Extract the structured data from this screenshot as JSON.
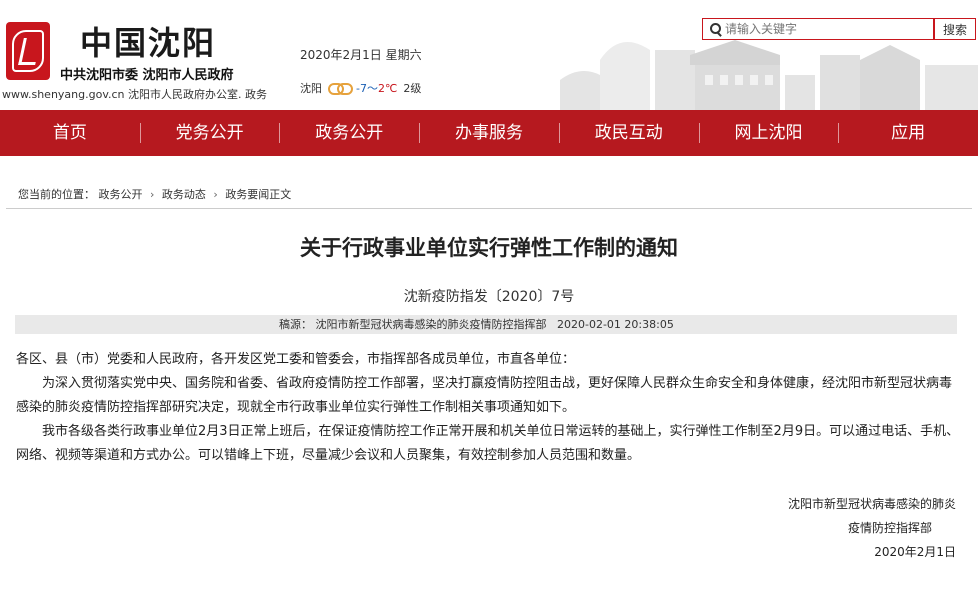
{
  "header": {
    "site_title": "中国沈阳",
    "sub_title": "中共沈阳市委   沈阳市人民政府",
    "domain_text": "www.shenyang.gov.cn 沈阳市人民政府办公室. 政务",
    "date": "2020年2月1日  星期六",
    "weather": {
      "city": "沈阳",
      "temp_low": "-7",
      "sep": "～",
      "temp_high": "2℃",
      "wind": "2级",
      "icon": "cloudy-icon"
    },
    "search": {
      "placeholder": "请输入关键字",
      "button": "搜索"
    }
  },
  "nav": {
    "items": [
      "首页",
      "党务公开",
      "政务公开",
      "办事服务",
      "政民互动",
      "网上沈阳",
      "应用"
    ]
  },
  "breadcrumb": {
    "label": "您当前的位置",
    "colon": "：",
    "items": [
      "政务公开",
      "政务动态",
      "政务要闻正文"
    ],
    "separator": "›"
  },
  "article": {
    "title": "关于行政事业单位实行弹性工作制的通知",
    "doc_number": "沈新疫防指发〔2020〕7号",
    "source_label": "稿源：",
    "source": "沈阳市新型冠状病毒感染的肺炎疫情防控指挥部",
    "time": "2020-02-01 20:38:05",
    "paragraphs": [
      "各区、县（市）党委和人民政府，各开发区党工委和管委会，市指挥部各成员单位，市直各单位：",
      "为深入贯彻落实党中央、国务院和省委、省政府疫情防控工作部署，坚决打赢疫情防控阻击战，更好保障人民群众生命安全和身体健康，经沈阳市新型冠状病毒感染的肺炎疫情防控指挥部研究决定，现就全市行政事业单位实行弹性工作制相关事项通知如下。",
      "我市各级各类行政事业单位2月3日正常上班后，在保证疫情防控工作正常开展和机关单位日常运转的基础上，实行弹性工作制至2月9日。可以通过电话、手机、网络、视频等渠道和方式办公。可以错峰上下班，尽量减少会议和人员聚集，有效控制参加人员范围和数量。"
    ],
    "signature_line1": "沈阳市新型冠状病毒感染的肺炎",
    "signature_line2": "疫情防控指挥部",
    "signature_date": "2020年2月1日"
  },
  "colors": {
    "brand_red": "#b6191f",
    "search_border": "#c8161d"
  }
}
